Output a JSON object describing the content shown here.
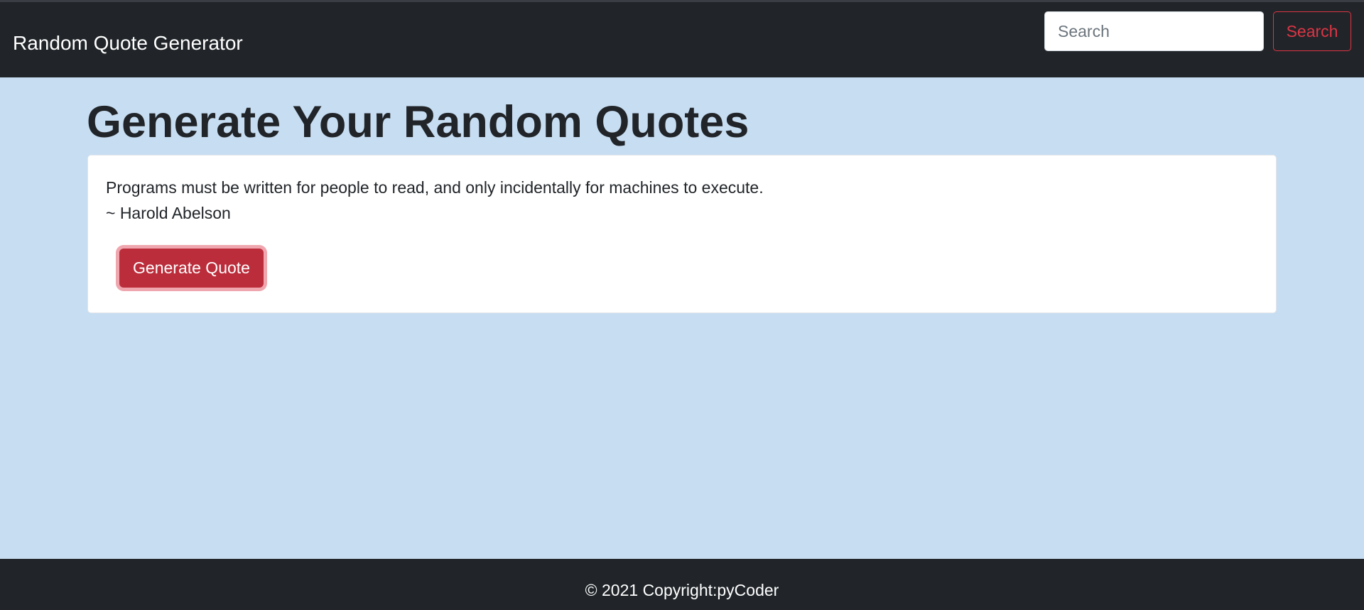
{
  "navbar": {
    "brand": "Random Quote Generator",
    "search_placeholder": "Search",
    "search_button_label": "Search"
  },
  "main": {
    "title": "Generate Your Random Quotes",
    "quote": {
      "text": "Programs must be written for people to read, and only incidentally for machines to execute.",
      "author": "~ Harold Abelson"
    },
    "generate_button_label": "Generate Quote"
  },
  "footer": {
    "text": "© 2021 Copyright:pyCoder"
  },
  "colors": {
    "navbar_bg": "#212529",
    "page_bg": "#c7ddf2",
    "accent_danger": "#dc3545",
    "button_bg": "#bb2d3b"
  }
}
